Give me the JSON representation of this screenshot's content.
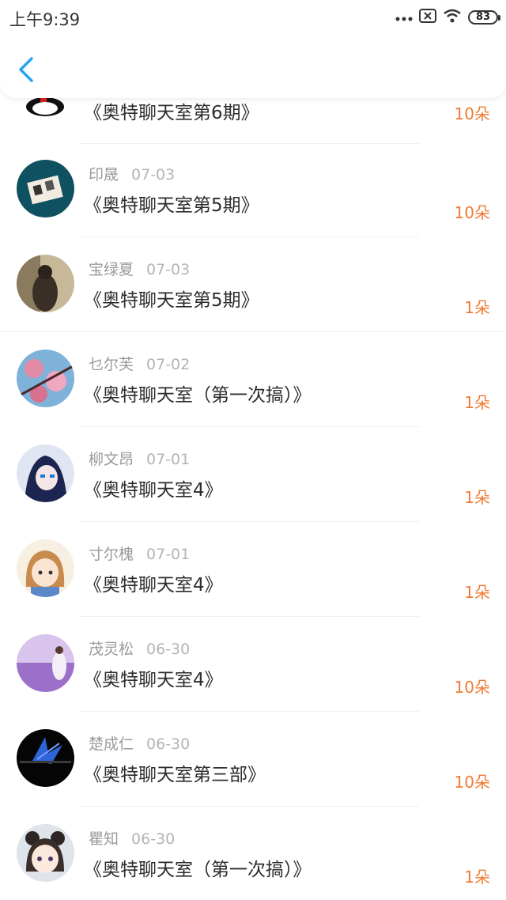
{
  "status_bar": {
    "time": "上午9:39",
    "battery": "83"
  },
  "nav": {
    "back_icon": "chevron-left-icon",
    "accent": "#2aa3f3"
  },
  "colors": {
    "amount": "#f07b34",
    "name": "#9a9a9a",
    "title": "#2c2c2c"
  },
  "rows": [
    {
      "name": "",
      "date": "",
      "title": "《奥特聊天室第6期》",
      "amount": "10朵"
    },
    {
      "name": "印晟",
      "date": "07-03",
      "title": "《奥特聊天室第5期》",
      "amount": "10朵"
    },
    {
      "name": "宝绿夏",
      "date": "07-03",
      "title": "《奥特聊天室第5期》",
      "amount": "1朵"
    },
    {
      "name": "乜尔芙",
      "date": "07-02",
      "title": "《奥特聊天室（第一次搞）》",
      "amount": "1朵"
    },
    {
      "name": "柳文昂",
      "date": "07-01",
      "title": "《奥特聊天室4》",
      "amount": "1朵"
    },
    {
      "name": "寸尔槐",
      "date": "07-01",
      "title": "《奥特聊天室4》",
      "amount": "1朵"
    },
    {
      "name": "茂灵松",
      "date": "06-30",
      "title": "《奥特聊天室4》",
      "amount": "10朵"
    },
    {
      "name": "楚成仁",
      "date": "06-30",
      "title": "《奥特聊天室第三部》",
      "amount": "10朵"
    },
    {
      "name": "瞿知",
      "date": "06-30",
      "title": "《奥特聊天室（第一次搞）》",
      "amount": "1朵"
    }
  ]
}
